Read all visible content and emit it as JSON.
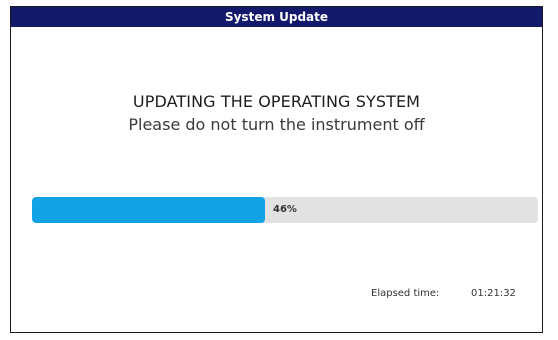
{
  "window": {
    "title": "System Update"
  },
  "message": {
    "heading": "UPDATING THE OPERATING SYSTEM",
    "subheading": "Please do not turn the instrument off"
  },
  "progress": {
    "percent": 46,
    "label": "46%",
    "fill_color": "#11a3e6",
    "track_color": "#e2e2e2"
  },
  "elapsed": {
    "label": "Elapsed time:",
    "value": "01:21:32"
  },
  "colors": {
    "titlebar": "#131a6b"
  }
}
